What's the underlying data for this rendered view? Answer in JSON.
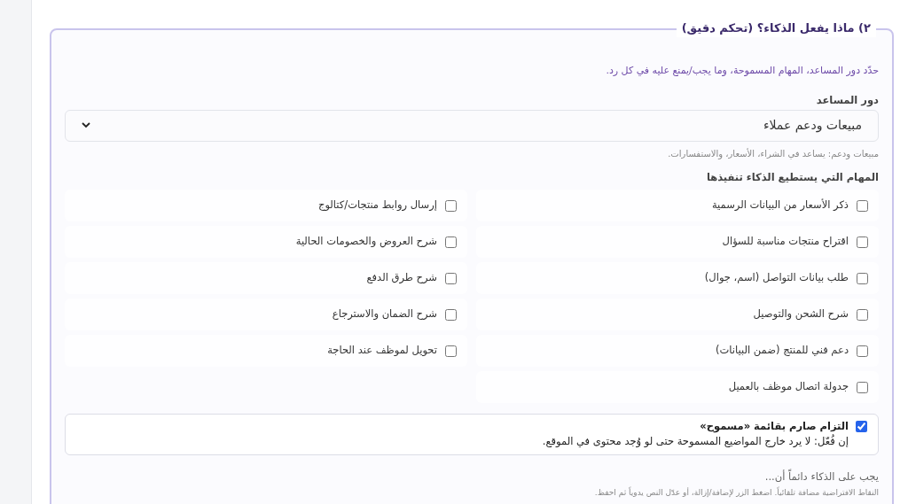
{
  "section": {
    "legend": "٢) ماذا يفعل الذكاء؟ (تحكم دقيق)",
    "description": "حدّد دور المساعد، المهام المسموحة، وما يجب/يمنع عليه في كل رد."
  },
  "role": {
    "label": "دور المساعد",
    "value": "مبيعات ودعم عملاء",
    "hint": "مبيعات ودعم: يساعد في الشراء، الأسعار، والاستفسارات."
  },
  "tasks": {
    "label": "المهام التي يستطيع الذكاء تنفيذها",
    "items": [
      {
        "label": "ذكر الأسعار من البيانات الرسمية",
        "checked": false
      },
      {
        "label": "إرسال روابط منتجات/كتالوج",
        "checked": false
      },
      {
        "label": "اقتراح منتجات مناسبة للسؤال",
        "checked": false
      },
      {
        "label": "شرح العروض والخصومات الحالية",
        "checked": false
      },
      {
        "label": "طلب بيانات التواصل (اسم، جوال)",
        "checked": false
      },
      {
        "label": "شرح طرق الدفع",
        "checked": false
      },
      {
        "label": "شرح الشحن والتوصيل",
        "checked": false
      },
      {
        "label": "شرح الضمان والاسترجاع",
        "checked": false
      },
      {
        "label": "دعم فني للمنتج (ضمن البيانات)",
        "checked": false
      },
      {
        "label": "تحويل لموظف عند الحاجة",
        "checked": false
      },
      {
        "label": "جدولة اتصال موظف بالعميل",
        "checked": false
      }
    ]
  },
  "strict": {
    "title": "التزام صارم بقائمة «مسموح»",
    "description": "إن فُعّل: لا يرد خارج المواضيع المسموحة حتى لو وُجد محتوى في الموقع.",
    "checked": true
  },
  "always": {
    "label": "يجب على الذكاء دائماً أن...",
    "hint": "النقاط الافتراضية مضافة تلقائياً. اضغط الزر لإضافة/إزالة، أو عدّل النص يدوياً ثم احفظ."
  }
}
